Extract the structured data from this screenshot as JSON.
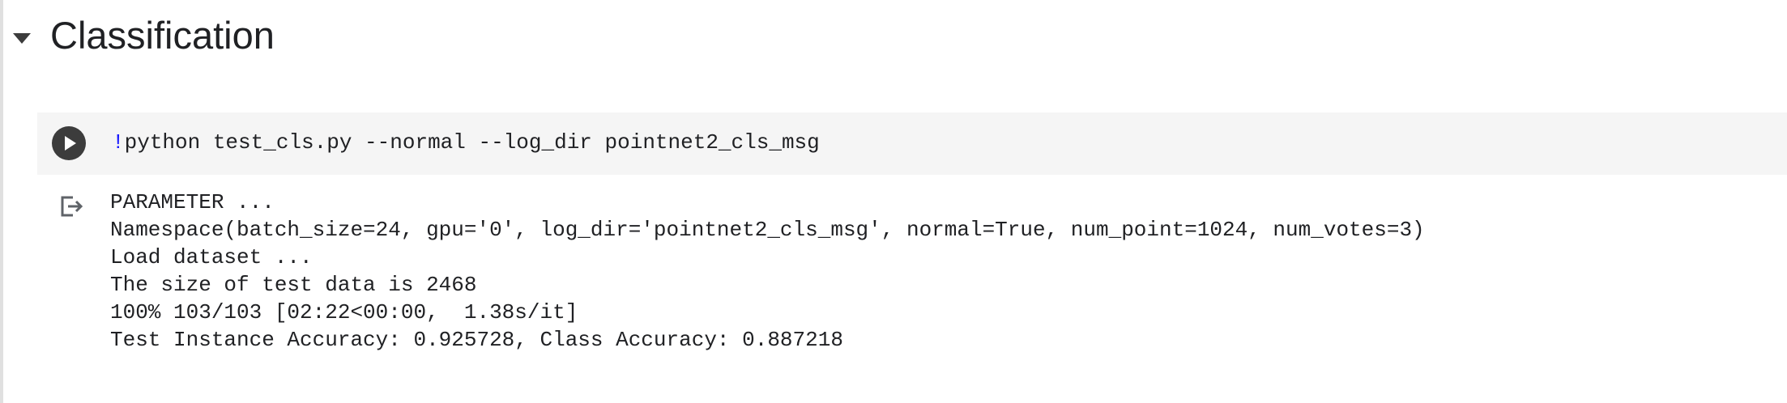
{
  "section": {
    "title": "Classification",
    "toggle_icon": "caret-down-icon"
  },
  "code_cell": {
    "run_icon": "play-icon",
    "bang": "!",
    "code": "python test_cls.py --normal --log_dir pointnet2_cls_msg"
  },
  "output": {
    "icon": "output-redirect-icon",
    "lines": [
      "PARAMETER ...",
      "Namespace(batch_size=24, gpu='0', log_dir='pointnet2_cls_msg', normal=True, num_point=1024, num_votes=3)",
      "Load dataset ...",
      "The size of test data is 2468",
      "100% 103/103 [02:22<00:00,  1.38s/it]",
      "Test Instance Accuracy: 0.925728, Class Accuracy: 0.887218"
    ]
  },
  "colors": {
    "cell_background": "#f5f5f5",
    "run_button": "#3c3c3c",
    "bang": "#1a1aff",
    "text": "#202124"
  }
}
